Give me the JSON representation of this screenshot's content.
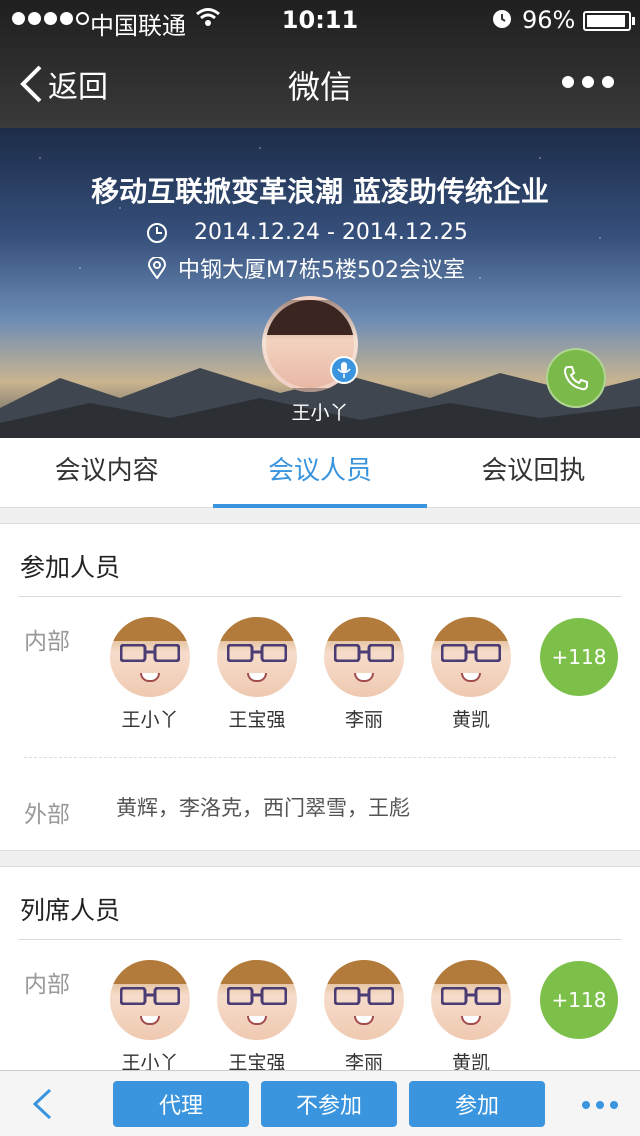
{
  "status_bar": {
    "carrier": "中国联通",
    "time": "10:11",
    "battery_percent": "96%",
    "battery_level": 0.96,
    "signal_bars_filled": 4,
    "signal_bars_total": 5
  },
  "nav": {
    "back_label": "返回",
    "title": "微信"
  },
  "meeting": {
    "title": "移动互联掀变革浪潮 蓝凌助传统企业",
    "date_range": "2014.12.24 - 2014.12.25",
    "location": "中钢大厦M7栋5楼502会议室",
    "host_name": "王小丫"
  },
  "tabs": [
    {
      "label": "会议内容",
      "active": false
    },
    {
      "label": "会议人员",
      "active": true
    },
    {
      "label": "会议回执",
      "active": false
    }
  ],
  "participants": {
    "title": "参加人员",
    "internal_label": "内部",
    "internal": [
      "王小丫",
      "王宝强",
      "李丽",
      "黄凯"
    ],
    "internal_more": "+118",
    "external_label": "外部",
    "external_text": "黄辉，李洛克，西门翠雪，王彪"
  },
  "attendees": {
    "title": "列席人员",
    "internal_label": "内部",
    "internal": [
      "王小丫",
      "王宝强",
      "李丽",
      "黄凯"
    ],
    "internal_more": "+118"
  },
  "toolbar": {
    "proxy_label": "代理",
    "decline_label": "不参加",
    "accept_label": "参加"
  },
  "colors": {
    "accent": "#3a95de",
    "green": "#7cc04a"
  },
  "icons": [
    "chevron-left-icon",
    "more-icon",
    "clock-icon",
    "location-pin-icon",
    "microphone-icon",
    "phone-icon",
    "wifi-icon",
    "alarm-icon"
  ]
}
